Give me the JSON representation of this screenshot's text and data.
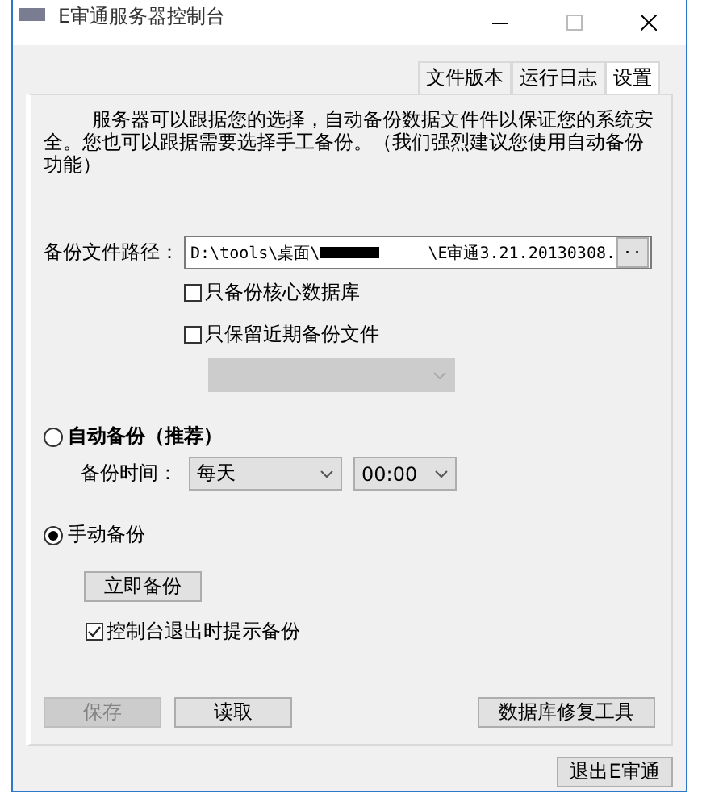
{
  "window": {
    "title": "E审通服务器控制台"
  },
  "tabs": [
    {
      "label": "文件版本",
      "selected": false
    },
    {
      "label": "运行日志",
      "selected": false
    },
    {
      "label": "设置",
      "selected": true
    }
  ],
  "description": "服务器可以跟据您的选择，自动备份数据文件件以保证您的系统安全。您也可以跟据需要选择手工备份。（我们强烈建议您使用自动备份功能）",
  "path": {
    "label": "备份文件路径：",
    "value_start": "D:\\tools\\桌面\\",
    "redacted": true,
    "value_end": "\\E审通3.21.20130308.",
    "browse": ".."
  },
  "options": [
    {
      "label": "只备份核心数据库",
      "checked": false
    },
    {
      "label": "只保留近期备份文件",
      "checked": false
    }
  ],
  "retention_select": {
    "disabled": true
  },
  "auto_backup": {
    "label": "自动备份（推荐）",
    "selected": false,
    "time_label": "备份时间：",
    "frequency": "每天",
    "time": "00:00"
  },
  "manual_backup": {
    "label": "手动备份",
    "selected": true,
    "button": "立即备份",
    "prompt": {
      "label": "控制台退出时提示备份",
      "checked": true
    }
  },
  "buttons": [
    {
      "label": "保存",
      "disabled": true
    },
    {
      "label": "读取",
      "disabled": false
    },
    {
      "label": "数据库修复工具",
      "disabled": false
    }
  ],
  "exit_button": "退出E审通"
}
